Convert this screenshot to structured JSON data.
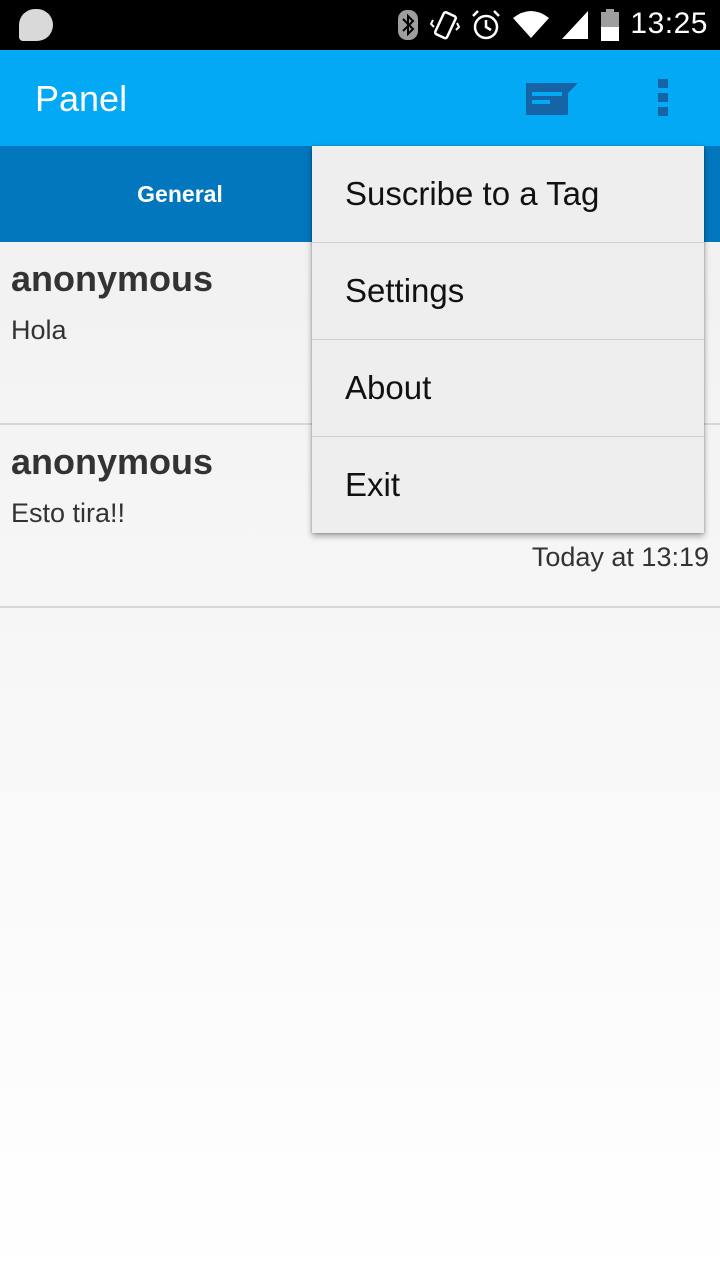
{
  "status_bar": {
    "time": "13:25",
    "icons": [
      "notification-icon",
      "bluetooth-icon",
      "vibrate-icon",
      "alarm-icon",
      "wifi-icon",
      "signal-icon",
      "battery-icon"
    ]
  },
  "action_bar": {
    "title": "Panel",
    "background_color": "#03a9f4",
    "icons": [
      "compose-message-icon",
      "overflow-menu-icon"
    ]
  },
  "tabs": [
    {
      "label": "General",
      "selected": true
    }
  ],
  "messages": [
    {
      "author": "anonymous",
      "text": "Hola",
      "time": ""
    },
    {
      "author": "anonymous",
      "text": "Esto tira!!",
      "time": "Today at 13:19"
    }
  ],
  "popup_menu": {
    "items": [
      "Suscribe to a Tag",
      "Settings",
      "About",
      "Exit"
    ]
  }
}
